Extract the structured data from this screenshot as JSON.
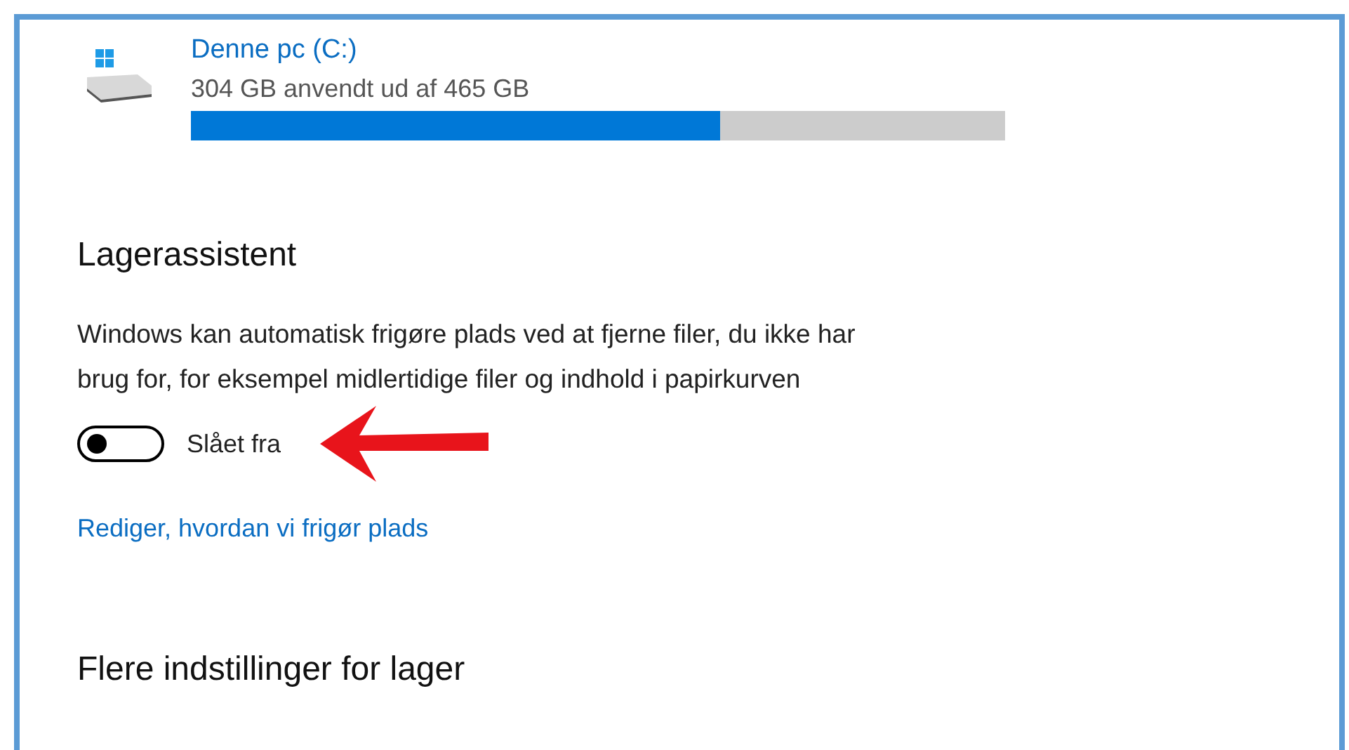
{
  "drive": {
    "name": "Denne pc (C:)",
    "usage": "304 GB anvendt ud af 465 GB",
    "level": 0.65
  },
  "storage_sense": {
    "heading": "Lagerassistent",
    "description": "Windows kan automatisk frigøre plads ved at fjerne filer, du ikke har brug for, for eksempel midlertidige filer og indhold i papirkurven",
    "toggle": {
      "on": false,
      "label": "Slået fra"
    },
    "link": "Rediger, hvordan vi frigør plads"
  },
  "more_settings": {
    "heading": "Flere indstillinger for lager"
  }
}
